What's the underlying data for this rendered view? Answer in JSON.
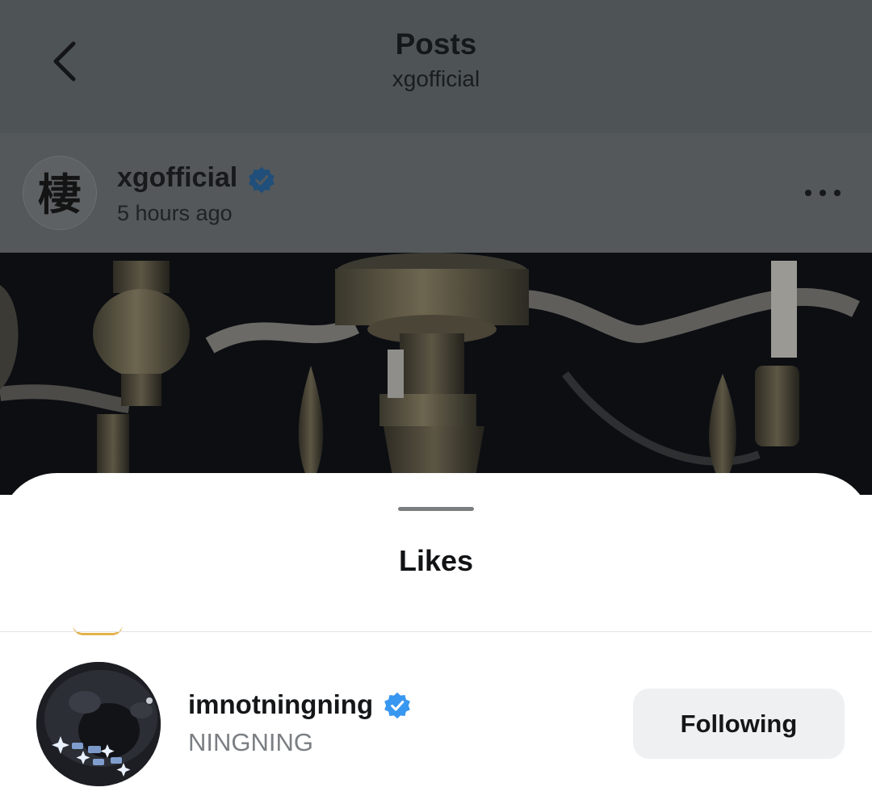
{
  "header": {
    "title": "Posts",
    "subtitle": "xgofficial",
    "back_icon": "chevron-left-icon"
  },
  "post": {
    "author": {
      "username": "xgofficial",
      "verified": true,
      "time": "5 hours ago",
      "avatar_glyph": "棲"
    },
    "more_icon": "more-horizontal-icon",
    "image_description": "chandelier"
  },
  "likes_sheet": {
    "title": "Likes",
    "likes": [
      {
        "username": "imnotningning",
        "full_name": "NINGNING",
        "verified": true,
        "follow_status": "Following"
      }
    ]
  },
  "colors": {
    "verified_badge": "#3897f0",
    "dim_overlay": "#4e5356",
    "button_bg": "#eff0f2",
    "secondary_text": "#7b7f83"
  }
}
